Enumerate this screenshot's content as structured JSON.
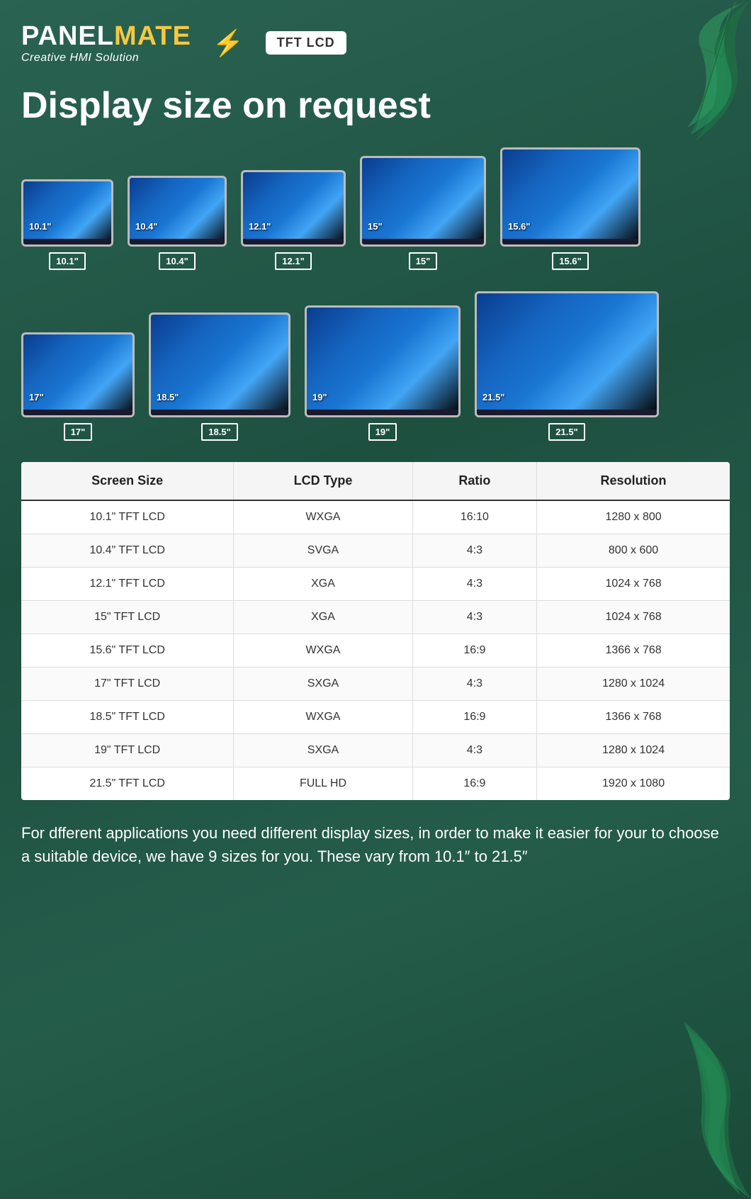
{
  "header": {
    "logo_panel": "PANEL",
    "logo_mate": "MATE",
    "logo_subtitle": "Creative HMI Solution",
    "tft_badge": "TFT LCD",
    "lightning": "⚡"
  },
  "main_heading": "Display size on request",
  "monitors_row1": [
    {
      "size": "10.1\"",
      "label": "10.1\"",
      "class": "mon-101"
    },
    {
      "size": "10.4\"",
      "label": "10.4\"",
      "class": "mon-104"
    },
    {
      "size": "12.1\"",
      "label": "12.1\"",
      "class": "mon-121"
    },
    {
      "size": "15\"",
      "label": "15\"",
      "class": "mon-15"
    },
    {
      "size": "15.6\"",
      "label": "15.6\"",
      "class": "mon-156"
    }
  ],
  "monitors_row2": [
    {
      "size": "17\"",
      "label": "17\"",
      "class": "mon-17"
    },
    {
      "size": "18.5\"",
      "label": "18.5\"",
      "class": "mon-185"
    },
    {
      "size": "19\"",
      "label": "19\"",
      "class": "mon-19"
    },
    {
      "size": "21.5\"",
      "label": "21.5\"",
      "class": "mon-215"
    }
  ],
  "table": {
    "headers": [
      "Screen Size",
      "LCD Type",
      "Ratio",
      "Resolution"
    ],
    "rows": [
      {
        "screen_size": "10.1\" TFT LCD",
        "lcd_type": "WXGA",
        "ratio": "16:10",
        "resolution": "1280 x 800"
      },
      {
        "screen_size": "10.4\" TFT LCD",
        "lcd_type": "SVGA",
        "ratio": "4:3",
        "resolution": "800 x 600"
      },
      {
        "screen_size": "12.1\" TFT LCD",
        "lcd_type": "XGA",
        "ratio": "4:3",
        "resolution": "1024 x 768"
      },
      {
        "screen_size": "15\" TFT LCD",
        "lcd_type": "XGA",
        "ratio": "4:3",
        "resolution": "1024 x 768"
      },
      {
        "screen_size": "15.6\" TFT LCD",
        "lcd_type": "WXGA",
        "ratio": "16:9",
        "resolution": "1366 x 768"
      },
      {
        "screen_size": "17\" TFT LCD",
        "lcd_type": "SXGA",
        "ratio": "4:3",
        "resolution": "1280 x 1024"
      },
      {
        "screen_size": "18.5\" TFT LCD",
        "lcd_type": "WXGA",
        "ratio": "16:9",
        "resolution": "1366 x 768"
      },
      {
        "screen_size": "19\" TFT LCD",
        "lcd_type": "SXGA",
        "ratio": "4:3",
        "resolution": "1280 x 1024"
      },
      {
        "screen_size": "21.5\" TFT LCD",
        "lcd_type": "FULL HD",
        "ratio": "16:9",
        "resolution": "1920 x 1080"
      }
    ]
  },
  "footer_text": "For dfferent applications you need different display sizes, in order to make  it easier for your  to choose a suitable device, we have 9 sizes for you. These vary from 10.1″ to 21.5″"
}
